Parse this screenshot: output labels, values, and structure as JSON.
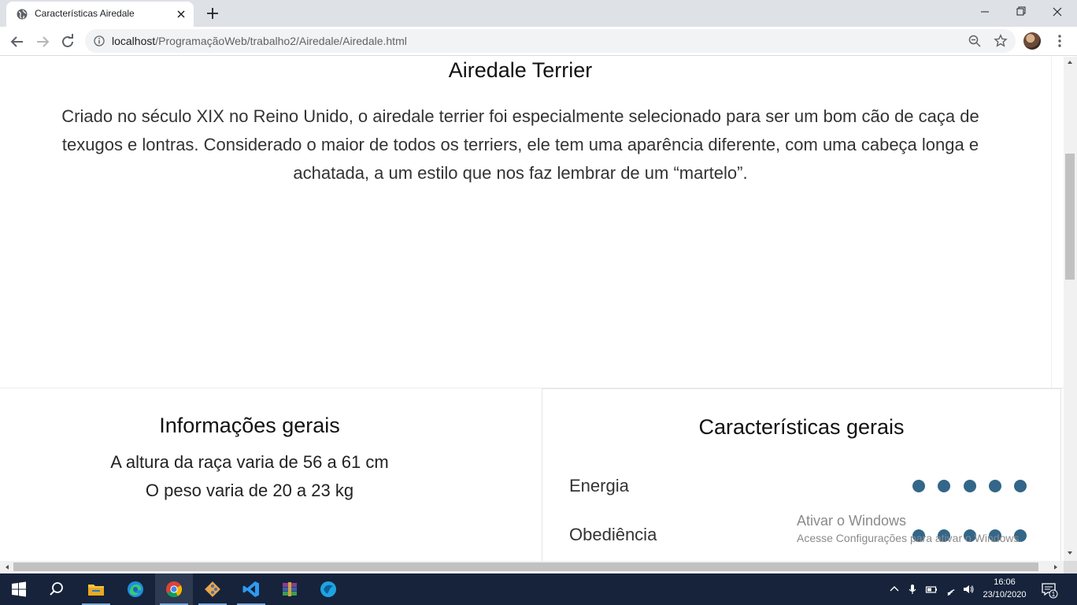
{
  "browser": {
    "tab_title": "Características Airedale",
    "url_host": "localhost",
    "url_path": "/ProgramaçãoWeb/trabalho2/Airedale/Airedale.html"
  },
  "page": {
    "title": "Airedale Terrier",
    "intro": "Criado no século XIX no Reino Unido, o airedale terrier foi especialmente selecionado para ser um bom cão de caça de texugos e lontras. Considerado o maior de todos os terriers, ele tem uma aparência diferente, com uma cabeça longa e achatada, a um estilo que nos faz lembrar de um “martelo”.",
    "info": {
      "title": "Informações gerais",
      "height": "A altura da raça varia de 56 a 61 cm",
      "weight": "O peso varia de 20 a 23 kg"
    },
    "traits": {
      "title": "Características gerais",
      "items": [
        {
          "label": "Energia",
          "rating": 5
        },
        {
          "label": "Obediência",
          "rating": 5
        }
      ]
    },
    "accent_color": "#336688"
  },
  "watermark": {
    "line1": "Ativar o Windows",
    "line2": "Acesse Configurações para ativar o Windows."
  },
  "taskbar": {
    "time": "16:06",
    "date": "23/10/2020",
    "notification_count": "1",
    "apps": [
      "windows-start",
      "search",
      "file-explorer",
      "edge",
      "chrome",
      "git",
      "vscode",
      "winrar",
      "browser-app"
    ]
  }
}
